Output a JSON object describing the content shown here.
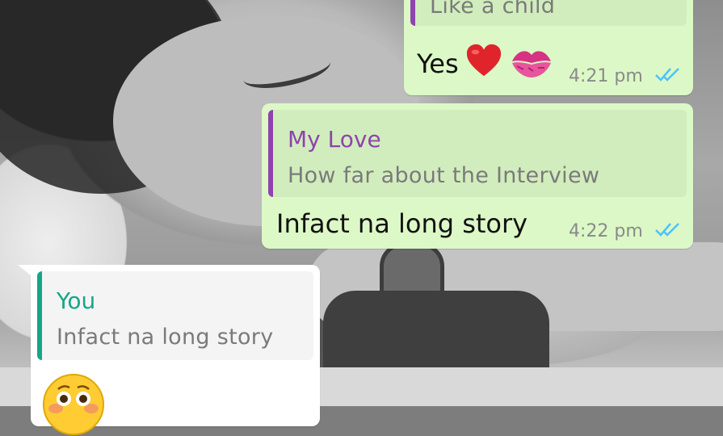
{
  "messages": [
    {
      "id": "msg1",
      "direction": "outgoing",
      "quote_text": "Like a child",
      "text": "Yes",
      "emojis": [
        "red-heart",
        "kiss-mark"
      ],
      "time": "4:21 pm",
      "status": "read"
    },
    {
      "id": "msg2",
      "direction": "outgoing",
      "quote_author": "My Love",
      "quote_text": "How far about the Interview",
      "text": "Infact na long story",
      "time": "4:22 pm",
      "status": "read"
    },
    {
      "id": "msg3",
      "direction": "incoming",
      "quote_author": "You",
      "quote_text": "Infact na long story",
      "emojis": [
        "flushed-face"
      ]
    }
  ],
  "colors": {
    "outgoing_bubble": "#dcf8c6",
    "incoming_bubble": "#ffffff",
    "quote_bar_my_love": "#8e44ad",
    "quote_bar_you": "#17a589",
    "read_ticks": "#4fc3f7"
  },
  "icons": {
    "read": "double-check-icon"
  }
}
